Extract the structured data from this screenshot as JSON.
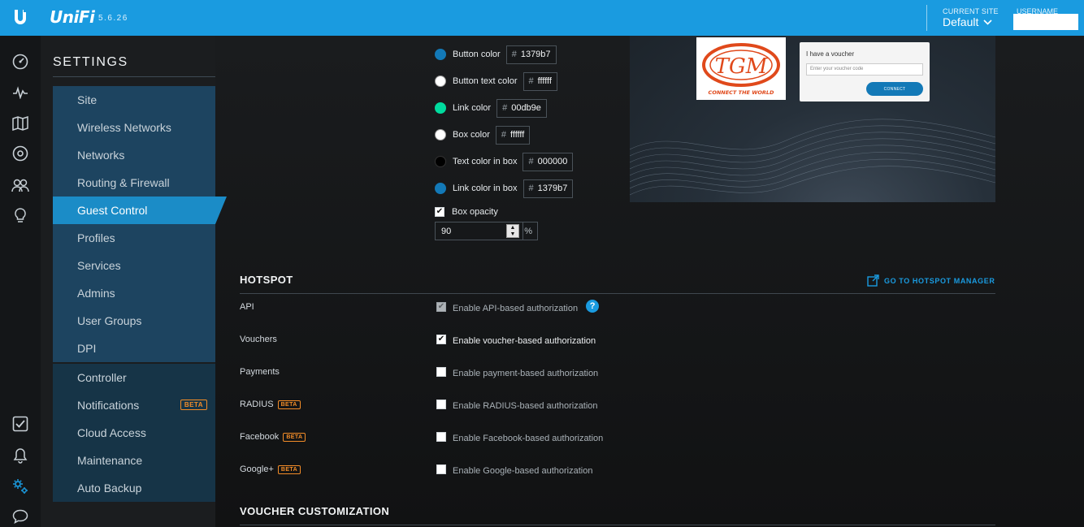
{
  "header": {
    "brand": "UniFi",
    "version": "5.6.26",
    "site_caption": "CURRENT SITE",
    "site_value": "Default",
    "user_caption": "USERNAME",
    "user_value": ""
  },
  "settings": {
    "title": "SETTINGS",
    "nav_main": [
      {
        "label": "Site"
      },
      {
        "label": "Wireless Networks"
      },
      {
        "label": "Networks"
      },
      {
        "label": "Routing & Firewall"
      },
      {
        "label": "Guest Control",
        "active": true
      },
      {
        "label": "Profiles"
      },
      {
        "label": "Services"
      },
      {
        "label": "Admins"
      },
      {
        "label": "User Groups"
      },
      {
        "label": "DPI"
      }
    ],
    "nav_secondary": [
      {
        "label": "Controller"
      },
      {
        "label": "Notifications",
        "badge": "BETA"
      },
      {
        "label": "Cloud Access"
      },
      {
        "label": "Maintenance"
      },
      {
        "label": "Auto Backup"
      }
    ]
  },
  "portal_colors": [
    {
      "label": "Button color",
      "value": "1379b7",
      "swatch": "#1379b7"
    },
    {
      "label": "Button text color",
      "value": "ffffff",
      "swatch": "#ffffff"
    },
    {
      "label": "Link color",
      "value": "00db9e",
      "swatch": "#00db9e"
    },
    {
      "label": "Box color",
      "value": "ffffff",
      "swatch": "#ffffff"
    },
    {
      "label": "Text color in box",
      "value": "000000",
      "swatch": "#000000"
    },
    {
      "label": "Link color in box",
      "value": "1379b7",
      "swatch": "#1379b7"
    }
  ],
  "hash": "#",
  "opacity": {
    "label": "Box opacity",
    "checked": true,
    "value": "90",
    "unit": "%"
  },
  "preview": {
    "voucher_title": "I have a voucher",
    "voucher_placeholder": "Enter your voucher code",
    "connect_label": "CONNECT",
    "logo_text": "TGM",
    "logo_tagline": "CONNECT THE WORLD"
  },
  "hotspot": {
    "title": "HOTSPOT",
    "manager_link": "GO TO HOTSPOT MANAGER",
    "rows": [
      {
        "label": "API",
        "option": "Enable API-based authorization",
        "checked": true,
        "disabled": true,
        "help": "?"
      },
      {
        "label": "Vouchers",
        "option": "Enable voucher-based authorization",
        "checked": true
      },
      {
        "label": "Payments",
        "option": "Enable payment-based authorization",
        "checked": false
      },
      {
        "label": "RADIUS",
        "badge": "BETA",
        "option": "Enable RADIUS-based authorization",
        "checked": false
      },
      {
        "label": "Facebook",
        "badge": "BETA",
        "option": "Enable Facebook-based authorization",
        "checked": false
      },
      {
        "label": "Google+",
        "badge": "BETA",
        "option": "Enable Google-based authorization",
        "checked": false
      }
    ]
  },
  "voucher_customization": {
    "title": "VOUCHER CUSTOMIZATION"
  },
  "colors": {
    "accent": "#1a9be0",
    "nav_active": "#1b8cc7",
    "beta": "#f28c28"
  }
}
